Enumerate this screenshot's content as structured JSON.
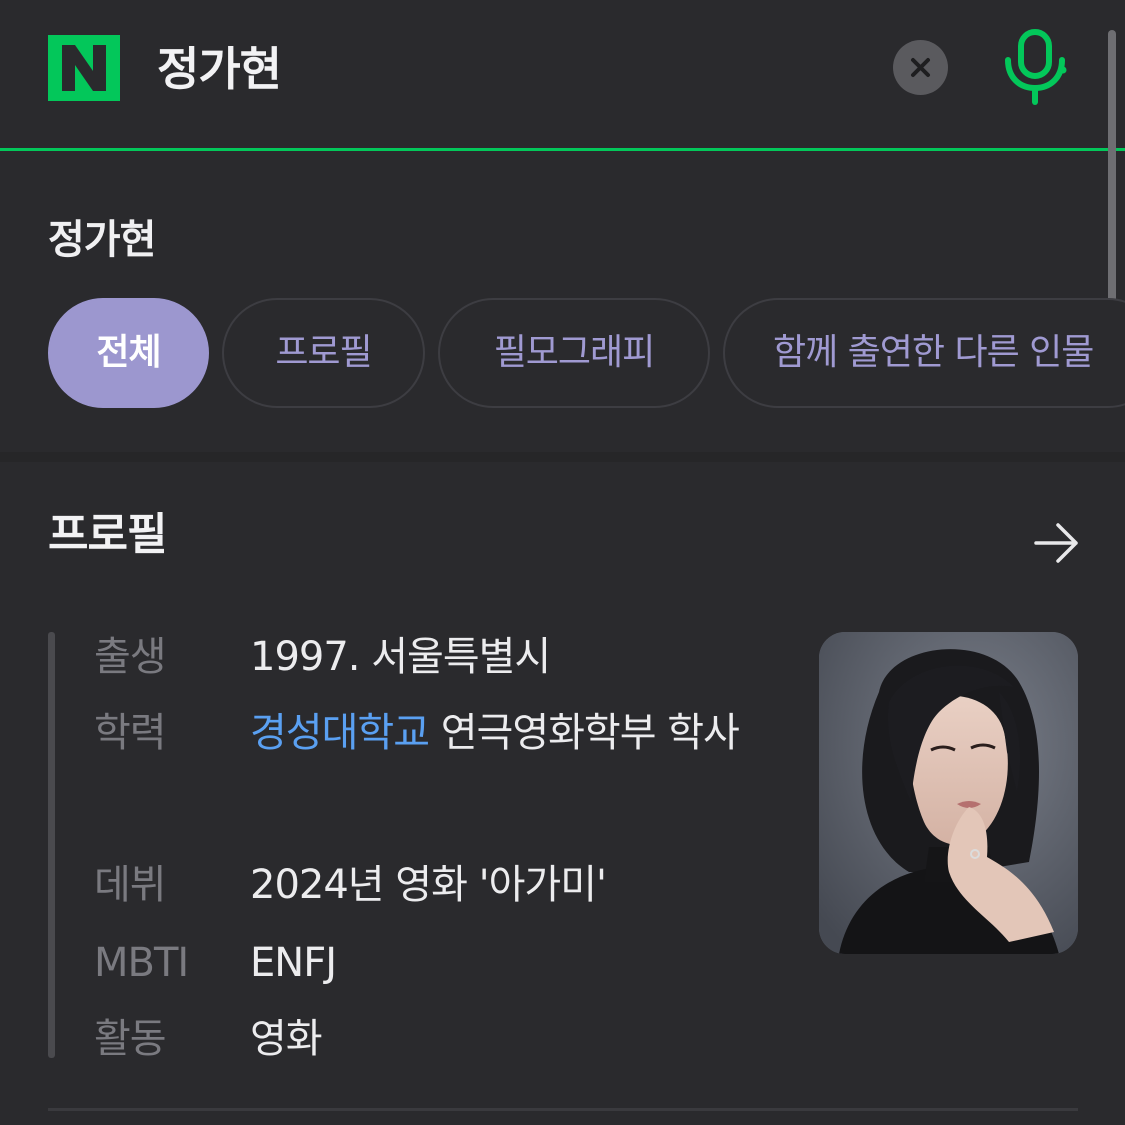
{
  "search": {
    "query": "정가현",
    "brand_color": "#03c75a",
    "logo_icon": "naver-n-logo",
    "clear_icon": "close-icon",
    "mic_icon": "microphone-icon"
  },
  "suggest": {
    "title": "정가현",
    "tabs": [
      {
        "label": "전체",
        "active": true
      },
      {
        "label": "프로필",
        "active": false
      },
      {
        "label": "필모그래피",
        "active": false
      },
      {
        "label": "함께 출연한 다른 인물",
        "active": false
      }
    ],
    "active_color": "#9c97cf"
  },
  "profile": {
    "title": "프로필",
    "more_icon": "arrow-right-icon",
    "rows": [
      {
        "label": "출생",
        "value": "1997. 서울특별시"
      },
      {
        "label": "학력",
        "value_link": "경성대학교",
        "value_rest": " 연극영화학부 학사"
      },
      {
        "label": "데뷔",
        "value": "2024년 영화 '아가미'"
      },
      {
        "label": "MBTI",
        "value": "ENFJ"
      },
      {
        "label": "활동",
        "value_link": "영화"
      }
    ],
    "photo_alt": "profile-photo"
  }
}
